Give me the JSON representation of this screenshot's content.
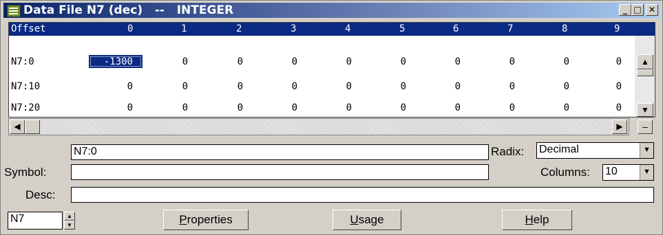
{
  "window": {
    "title": "Data File N7 (dec)   --   INTEGER",
    "buttons": {
      "minimize": "_",
      "maximize": "□",
      "close": "✕"
    }
  },
  "grid": {
    "offset_header": "Offset",
    "columns": [
      "0",
      "1",
      "2",
      "3",
      "4",
      "5",
      "6",
      "7",
      "8",
      "9"
    ],
    "rows": [
      {
        "label": "N7:0",
        "values": [
          "-1300",
          "0",
          "0",
          "0",
          "0",
          "0",
          "0",
          "0",
          "0",
          "0"
        ]
      },
      {
        "label": "N7:10",
        "values": [
          "0",
          "0",
          "0",
          "0",
          "0",
          "0",
          "0",
          "0",
          "0",
          "0"
        ]
      },
      {
        "label": "N7:20",
        "values": [
          "0",
          "0",
          "0",
          "0",
          "0",
          "0",
          "0",
          "0",
          "0",
          "0"
        ]
      }
    ],
    "selected": "N7:0"
  },
  "address_field": "N7:0",
  "radix": {
    "label": "Radix:",
    "value": "Decimal"
  },
  "symbol": {
    "label": "Symbol:",
    "value": ""
  },
  "columns_setting": {
    "label": "Columns:",
    "value": "10"
  },
  "desc": {
    "label": "Desc:",
    "value": ""
  },
  "file_spinner": "N7",
  "buttons": {
    "properties_first": "P",
    "properties_rest": "roperties",
    "usage_first": "U",
    "usage_rest": "sage",
    "help_first": "H",
    "help_rest": "elp"
  }
}
